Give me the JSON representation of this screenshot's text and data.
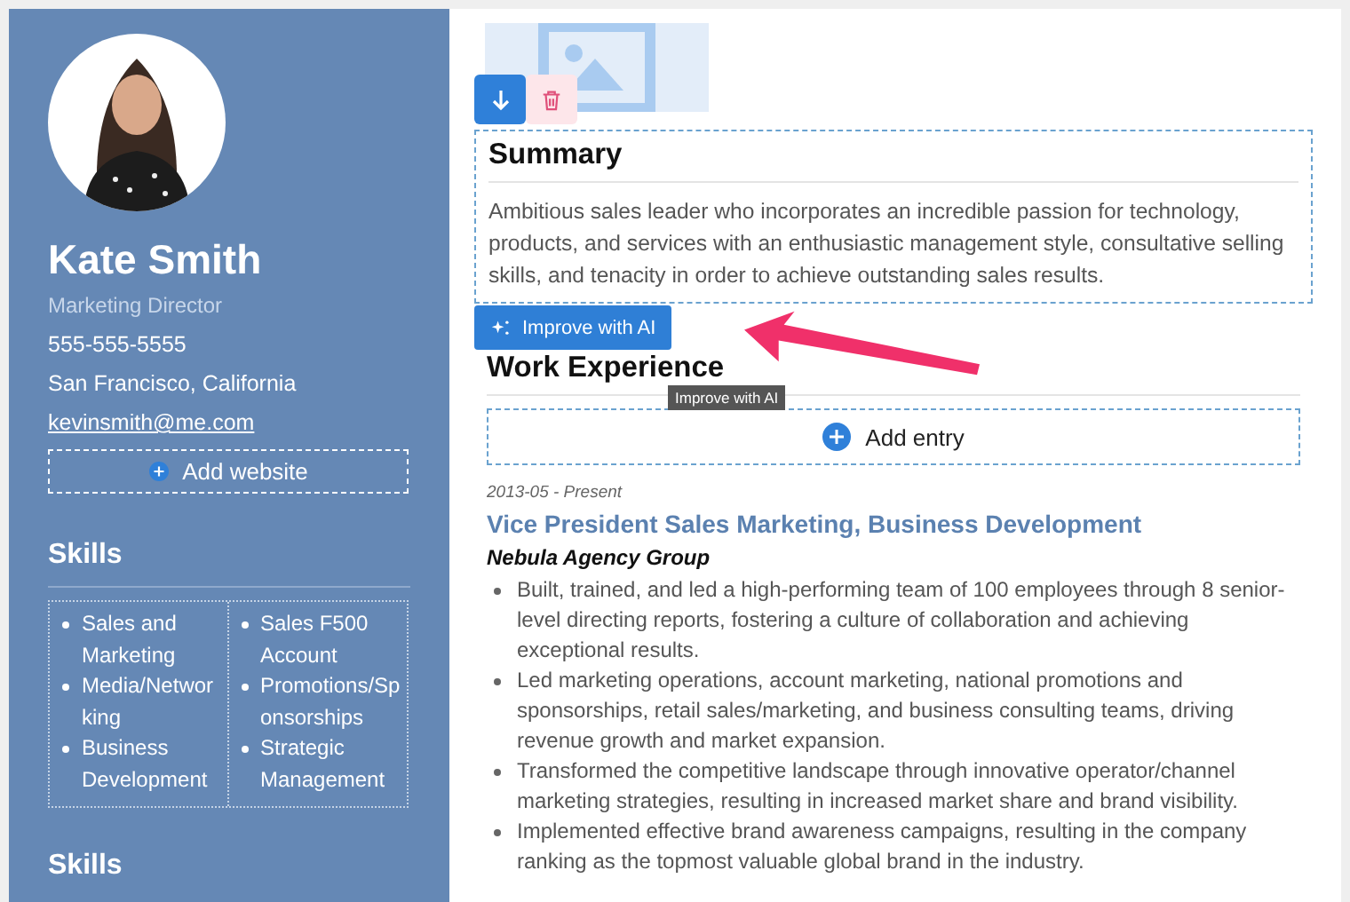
{
  "profile": {
    "name": "Kate Smith",
    "title": "Marketing Director",
    "phone": "555-555-5555",
    "location": "San Francisco, California",
    "email": "kevinsmith@me.com",
    "add_website": "Add website"
  },
  "skills": {
    "heading": "Skills",
    "columns": [
      [
        "Sales and Marketing",
        "Media/Networking",
        "Business Development"
      ],
      [
        "Sales F500 Account",
        "Promotions/Sponsorships",
        "Strategic Management"
      ]
    ]
  },
  "skills_2": {
    "heading": "Skills"
  },
  "summary": {
    "heading": "Summary",
    "text": "Ambitious sales leader who incorporates an incredible passion for technology, products, and services with an enthusiastic management style, consultative selling skills, and tenacity in order to achieve outstanding sales results."
  },
  "ai_button": {
    "label": "Improve with AI",
    "tooltip": "Improve with AI"
  },
  "work_experience": {
    "heading": "Work Experience",
    "add_entry": "Add entry",
    "entries": [
      {
        "dates": "2013-05 - Present",
        "role": "Vice President Sales Marketing, Business Development",
        "company": "Nebula Agency Group",
        "bullets": [
          "Built, trained, and led a high-performing team of 100 employees through 8 senior-level directing reports, fostering a culture of collaboration and achieving exceptional results.",
          "Led marketing operations, account marketing, national promotions and sponsorships, retail sales/marketing, and business consulting teams, driving revenue growth and market expansion.",
          "Transformed the competitive landscape through innovative operator/channel marketing strategies, resulting in increased market share and brand visibility.",
          "Implemented effective brand awareness campaigns, resulting in the company ranking as the topmost valuable global brand in the industry."
        ]
      }
    ]
  }
}
